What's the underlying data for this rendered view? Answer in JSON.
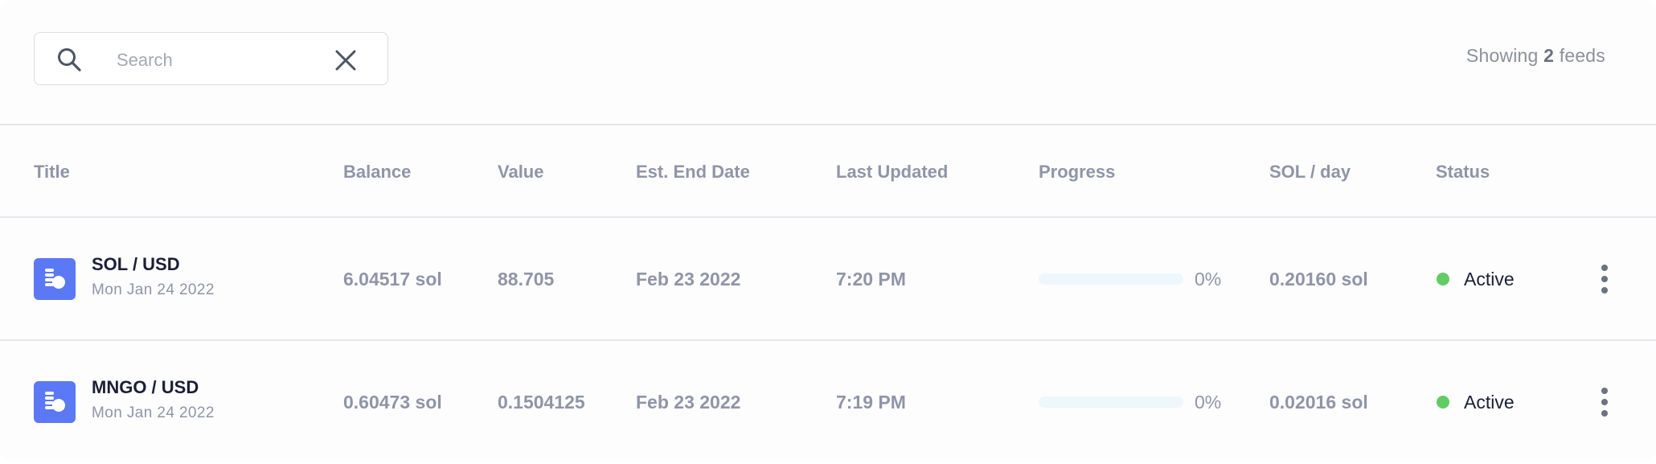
{
  "search": {
    "placeholder": "Search",
    "value": ""
  },
  "summary": {
    "prefix": "Showing",
    "count": "2",
    "suffix": "feeds"
  },
  "columns": [
    "Title",
    "Balance",
    "Value",
    "Est. End Date",
    "Last Updated",
    "Progress",
    "SOL / day",
    "Status"
  ],
  "feeds": [
    {
      "title": "SOL / USD",
      "created": "Mon Jan 24 2022",
      "balance": "6.04517 sol",
      "value": "88.705",
      "end_date": "Feb 23 2022",
      "last_updated": "7:20 PM",
      "progress": 0,
      "progress_label": "0%",
      "sol_per_day": "0.20160 sol",
      "status": "Active"
    },
    {
      "title": "MNGO / USD",
      "created": "Mon Jan 24 2022",
      "balance": "0.60473 sol",
      "value": "0.1504125",
      "end_date": "Feb 23 2022",
      "last_updated": "7:19 PM",
      "progress": 0,
      "progress_label": "0%",
      "sol_per_day": "0.02016 sol",
      "status": "Active"
    }
  ],
  "colors": {
    "accent": "#5b78f5",
    "status_active": "#62cc63",
    "text_muted": "#8f95a8",
    "text_strong": "#1a1f36"
  },
  "icons": [
    "search-icon",
    "clear-icon",
    "coins-icon",
    "more-vertical-icon"
  ]
}
